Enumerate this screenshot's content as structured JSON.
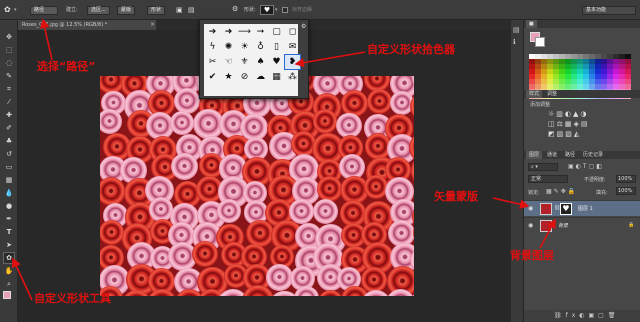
{
  "option_bar": {
    "mode_value": "路径",
    "make_label": "建立:",
    "selection_btn": "选区...",
    "mask_btn": "蒙版",
    "shape_btn": "形状",
    "shape_label": "形状:",
    "align_edges": "对齐边缘",
    "workspace_value": "基本功能"
  },
  "document_tab": "Roses_001.jpg @ 12.5% (RGB/8) *",
  "right_panel": {
    "styles_tabs": [
      "样式",
      "调整"
    ],
    "adjust_title": "添加调整",
    "layers_tabs": [
      "图层",
      "通道",
      "路径",
      "历史记录"
    ],
    "blend_mode": "正常",
    "opacity_label": "不透明度:",
    "opacity_value": "100%",
    "lock_label": "锁定:",
    "fill_label": "填充:",
    "fill_value": "100%",
    "layers": [
      {
        "name": "图层 1"
      },
      {
        "name": "背景"
      }
    ]
  },
  "annotations": {
    "select_path": "选择“路径”",
    "shape_picker": "自定义形状拾色器",
    "vector_mask": "矢量蒙版",
    "background_layer": "背景图层",
    "custom_shape_tool": "自定义形状工具"
  },
  "colors": {
    "annotation_red": "#e01010",
    "rose_red": "#c8201e",
    "rose_pink": "#e68aa8"
  }
}
